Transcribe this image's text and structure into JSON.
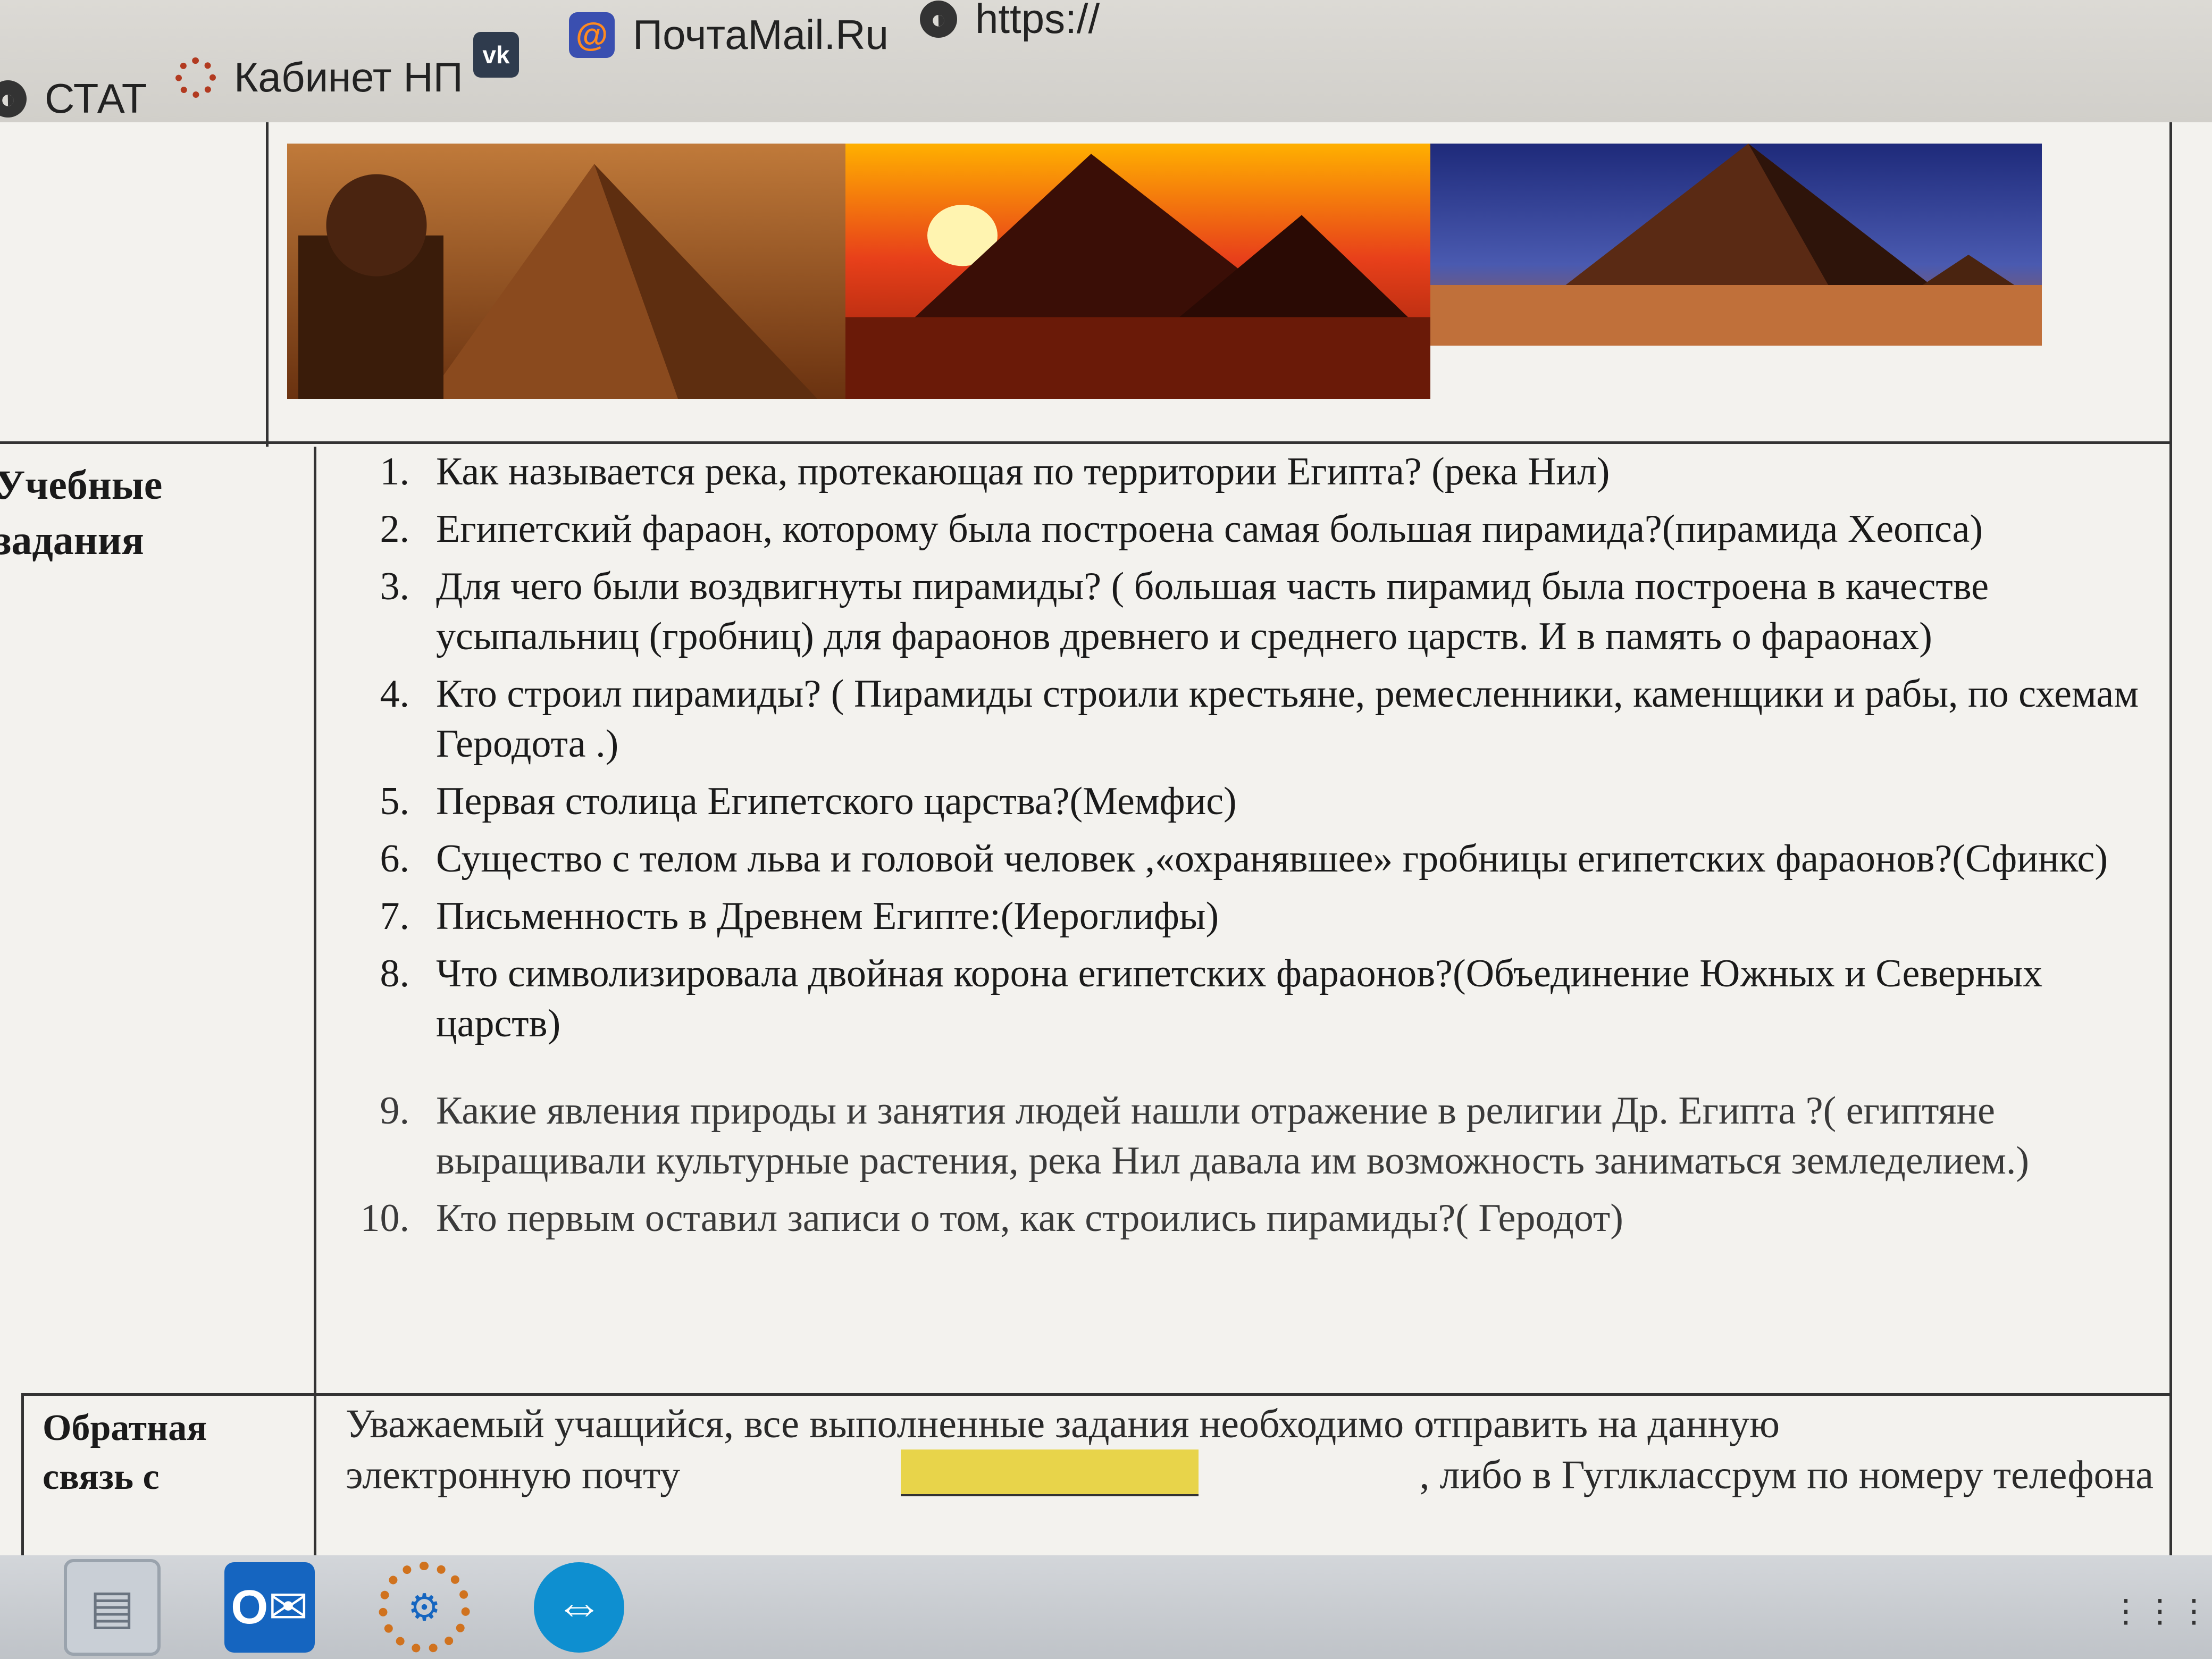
{
  "browser": {
    "bookmarks": [
      {
        "label": "СТАТ",
        "icon": "globe-icon"
      },
      {
        "label": "Кабинет НП",
        "icon": "gear-icon"
      },
      {
        "label": "",
        "icon": "vk-icon",
        "icon_text": "vk"
      },
      {
        "label": "ПочтаMail.Ru",
        "icon": "mail-icon",
        "icon_text": "@"
      },
      {
        "label": "https://",
        "icon": "globe-icon"
      }
    ]
  },
  "document": {
    "row_labels": {
      "tasks": [
        "Учебные",
        "задания"
      ],
      "feedback": [
        "Обратная",
        "связь с"
      ]
    },
    "questions": [
      {
        "num": "1.",
        "text": "Как называется река, протекающая по территории Египта? (река Нил)"
      },
      {
        "num": "2.",
        "text": "Египетский фараон, которому была построена самая большая пирамида?(пирамида Хеопса)"
      },
      {
        "num": "3.",
        "text": "Для чего были воздвигнуты пирамиды? ( большая часть пирамид была построена в качестве усыпальниц (гробниц) для фараонов древнего и среднего царств. И в память о фараонах)"
      },
      {
        "num": "4.",
        "text": "Кто строил пирамиды? ( Пирамиды строили крестьяне, ремесленники, каменщики и рабы, по схемам Геродота .)"
      },
      {
        "num": "5.",
        "text": "Первая столица Египетского царства?(Мемфис)"
      },
      {
        "num": "6.",
        "text": "Существо с телом льва и головой человек ,«охранявшее» гробницы египетских фараонов?(Сфинкс)"
      },
      {
        "num": "7.",
        "text": "Письменность в Древнем Египте:(Иероглифы)"
      },
      {
        "num": "8.",
        "text": "Что символизировала двойная корона египетских фараонов?(Объединение Южных и Северных царств)"
      },
      {
        "num": "9.",
        "text": "Какие явления природы и занятия людей нашли отражение в религии Др. Египта ?( египтяне выращивали культурные растения, река Нил давала им возможность заниматься земледелием.)"
      },
      {
        "num": "10.",
        "text": "Кто первым оставил записи о том, как строились пирамиды?( Геродот)"
      }
    ],
    "feedback": {
      "line1": "Уважаемый учащийся, все выполненные задания необходимо отправить на данную",
      "line2_a": "электронную почту",
      "line2_b": ", либо в Гуглклассрум по номеру телефона"
    }
  },
  "taskbar": {
    "apps": [
      {
        "name": "printer-app-icon",
        "glyph": "▤"
      },
      {
        "name": "outlook-app-icon",
        "glyph": "O✉"
      },
      {
        "name": "settings-app-icon",
        "glyph": "⚙"
      },
      {
        "name": "teamviewer-app-icon",
        "glyph": "⇔"
      }
    ],
    "tray": "⋮⋮⋮"
  },
  "colors": {
    "highlight": "#e8d44a",
    "table_border": "#333333",
    "page_bg": "#f3f2ee"
  }
}
